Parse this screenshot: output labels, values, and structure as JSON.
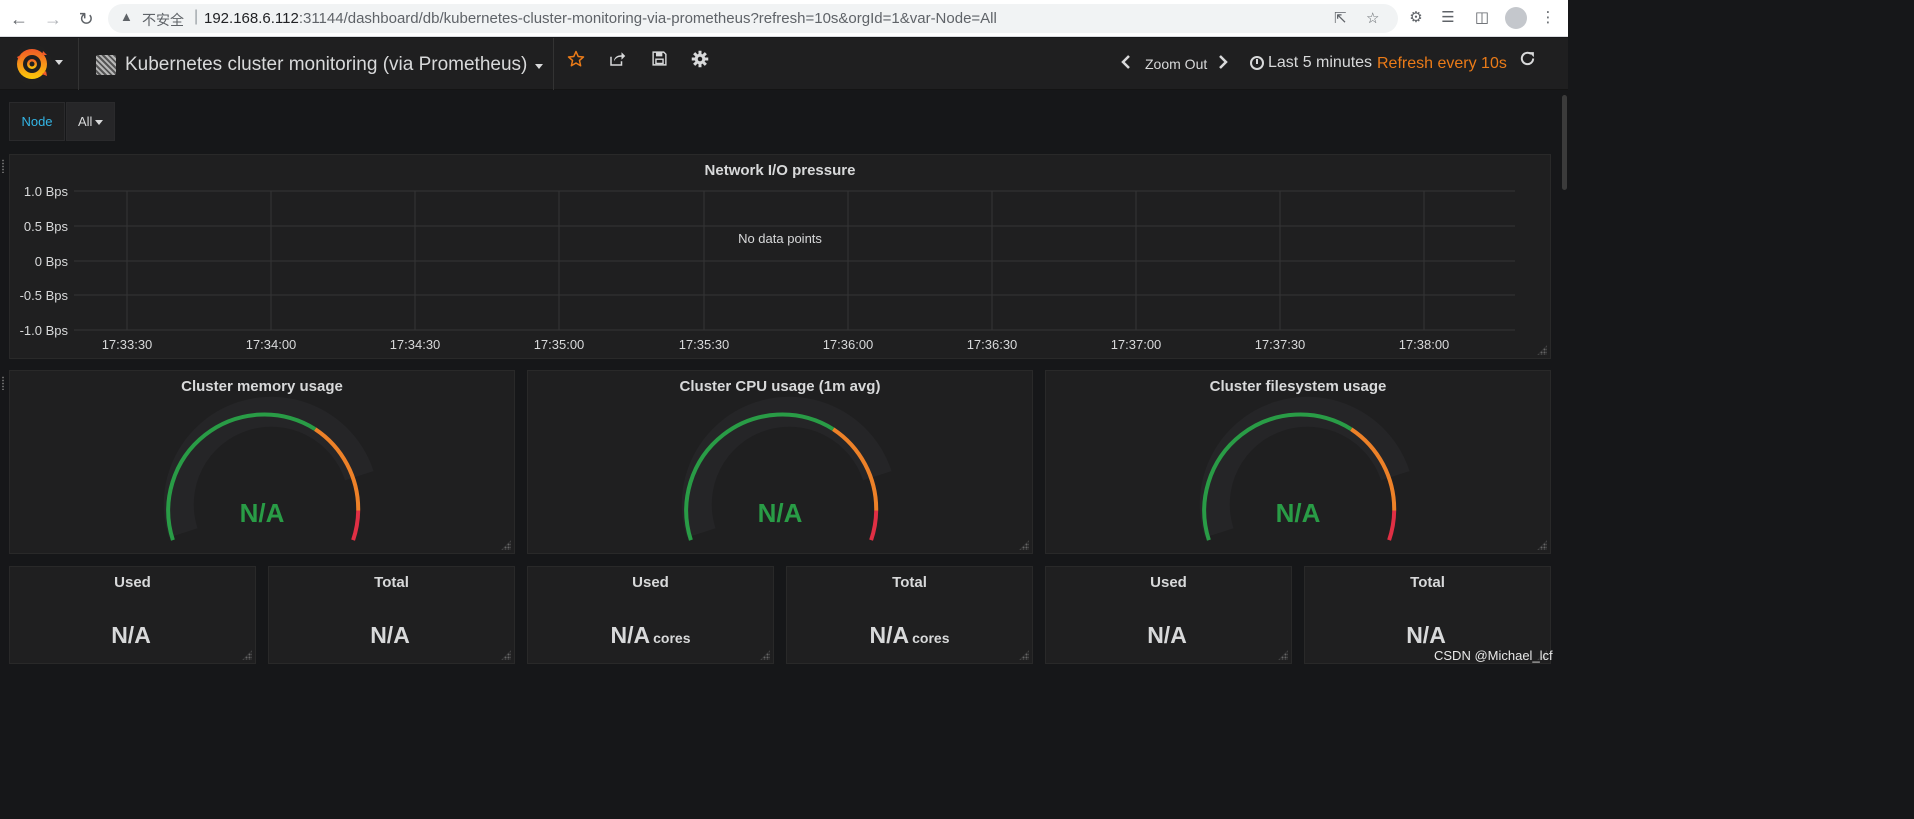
{
  "browser": {
    "insecure_label": "不安全",
    "url_host": "192.168.6.112",
    "url_rest": ":31144/dashboard/db/kubernetes-cluster-monitoring-via-prometheus?refresh=10s&orgId=1&var-Node=All"
  },
  "navbar": {
    "dashboard_title": "Kubernetes cluster monitoring (via Prometheus)",
    "zoom_out_label": "Zoom Out",
    "time_range_label": "Last 5 minutes",
    "refresh_label": "Refresh every 10s"
  },
  "template_vars": {
    "node_label": "Node",
    "node_value": "All"
  },
  "network_panel": {
    "title": "Network I/O pressure",
    "no_data": "No data points",
    "y_ticks": [
      "1.0 Bps",
      "0.5 Bps",
      "0 Bps",
      "-0.5 Bps",
      "-1.0 Bps"
    ],
    "x_ticks": [
      "17:33:30",
      "17:34:00",
      "17:34:30",
      "17:35:00",
      "17:35:30",
      "17:36:00",
      "17:36:30",
      "17:37:00",
      "17:37:30",
      "17:38:00"
    ]
  },
  "gauges": [
    {
      "title": "Cluster memory usage",
      "value": "N/A"
    },
    {
      "title": "Cluster CPU usage (1m avg)",
      "value": "N/A"
    },
    {
      "title": "Cluster filesystem usage",
      "value": "N/A"
    }
  ],
  "stats": [
    {
      "title": "Used",
      "value": "N/A",
      "unit": ""
    },
    {
      "title": "Total",
      "value": "N/A",
      "unit": ""
    },
    {
      "title": "Used",
      "value": "N/A",
      "unit": "cores"
    },
    {
      "title": "Total",
      "value": "N/A",
      "unit": "cores"
    },
    {
      "title": "Used",
      "value": "N/A",
      "unit": ""
    },
    {
      "title": "Total",
      "value": "N/A",
      "unit": ""
    }
  ],
  "watermark": "CSDN @Michael_lcf",
  "colors": {
    "accent_orange": "#eb7b18",
    "gauge_green": "#299c46",
    "gauge_orange": "#ed8128",
    "gauge_red": "#e02f44",
    "node_label_blue": "#33b5e5"
  }
}
